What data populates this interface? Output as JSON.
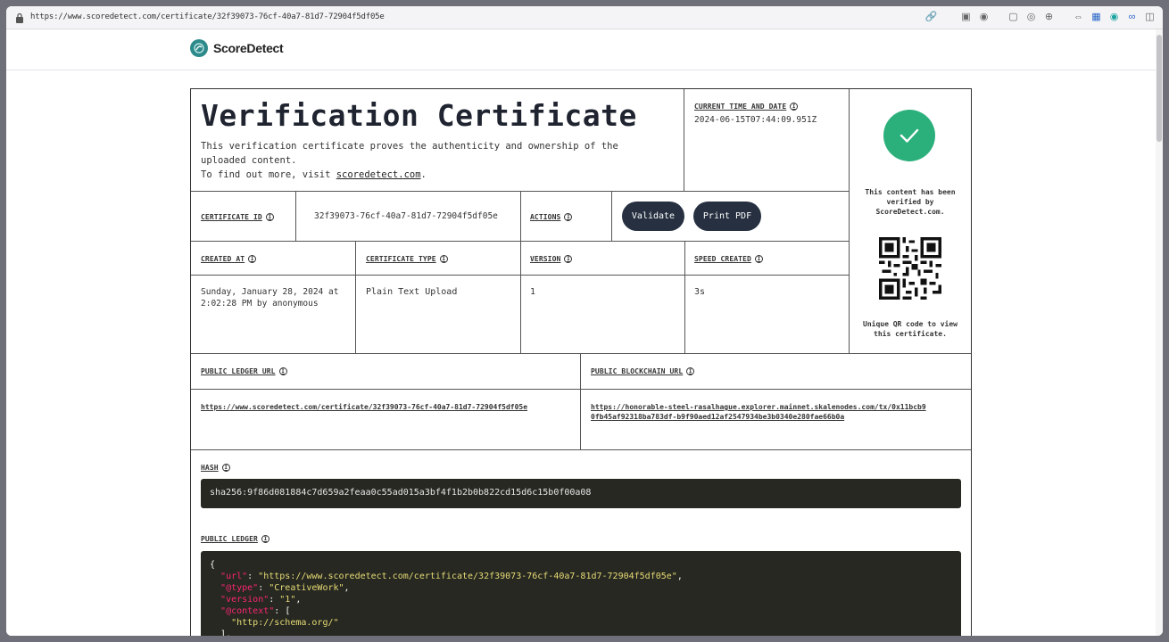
{
  "browser": {
    "url": "https://www.scoredetect.com/certificate/32f39073-76cf-40a7-81d7-72904f5df05e"
  },
  "brand": {
    "name": "ScoreDetect"
  },
  "certificate": {
    "title": "Verification Certificate",
    "description_line1": "This verification certificate proves the authenticity and ownership of the uploaded content.",
    "description_prefix": "To find out more, visit ",
    "description_link": "scoredetect.com",
    "description_suffix": ".",
    "current_time_label": "CURRENT TIME AND DATE",
    "current_time_value": "2024-06-15T07:44:09.951Z",
    "certificate_id_label": "CERTIFICATE ID",
    "certificate_id_value": "32f39073-76cf-40a7-81d7-72904f5df05e",
    "actions_label": "ACTIONS",
    "validate_label": "Validate",
    "print_label": "Print PDF",
    "created_at_label": "CREATED AT",
    "created_at_value": "Sunday, January 28, 2024 at 2:02:28 PM by anonymous",
    "type_label": "CERTIFICATE TYPE",
    "type_value": "Plain Text Upload",
    "version_label": "VERSION",
    "version_value": "1",
    "speed_label": "SPEED CREATED",
    "speed_value": "3s",
    "ledger_url_label": "PUBLIC LEDGER URL",
    "ledger_url_value": "https://www.scoredetect.com/certificate/32f39073-76cf-40a7-81d7-72904f5df05e",
    "blockchain_url_label": "PUBLIC BLOCKCHAIN URL",
    "blockchain_url_value": "https://honorable-steel-rasalhague.explorer.mainnet.skalenodes.com/tx/0x11bcb90fb45af92318ba783df-b9f90aed12af2547934be3b0340e280fae66b0a",
    "hash_label": "HASH",
    "hash_value": "sha256:9f86d081884c7d659a2feaa0c55ad015a3bf4f1b2b0b822cd15d6c15b0f00a08",
    "public_ledger_label": "PUBLIC LEDGER",
    "verified_text": "This content has been verified by ScoreDetect.com.",
    "qr_text": "Unique QR code to view this certificate."
  },
  "ledger": {
    "open": "{",
    "url_key": "\"url\"",
    "url_val": "\"https://www.scoredetect.com/certificate/32f39073-76cf-40a7-81d7-72904f5df05e\"",
    "type_key": "\"@type\"",
    "type_val": "\"CreativeWork\"",
    "version_key": "\"version\"",
    "version_val": "\"1\"",
    "context_key": "\"@context\"",
    "context_open": "[",
    "context_item": "\"http://schema.org/\"",
    "context_close": "],"
  },
  "colors": {
    "check": "#2bb07c",
    "button": "#263040",
    "code_bg": "#272822"
  }
}
